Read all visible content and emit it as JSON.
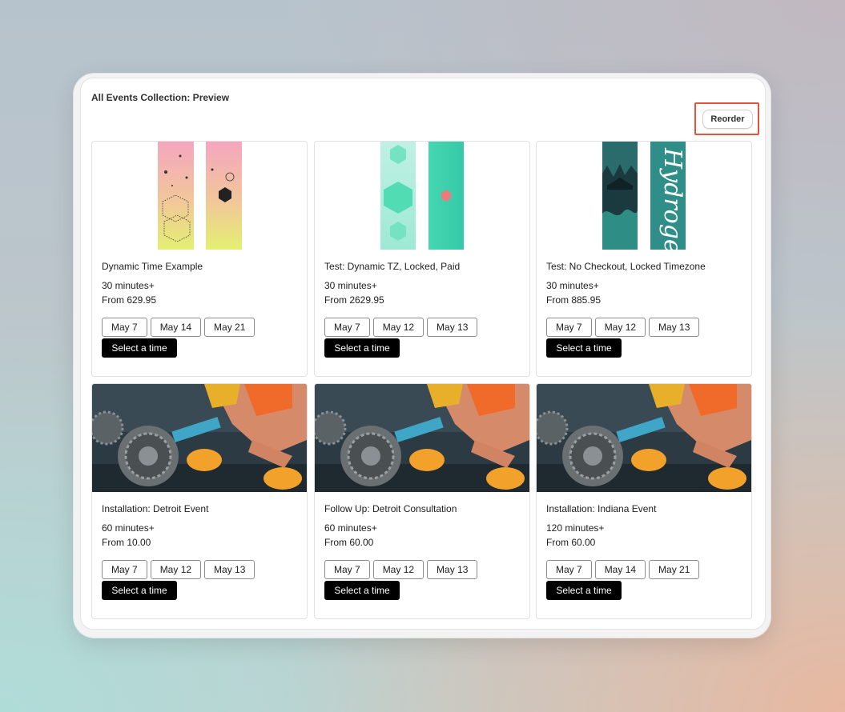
{
  "page": {
    "title": "All Events Collection: Preview",
    "reorder_label": "Reorder"
  },
  "products": [
    {
      "name": "Dynamic Time Example",
      "duration": "30 minutes+",
      "price": "From 629.95",
      "dates": [
        "May 7",
        "May 14",
        "May 21"
      ],
      "cta": "Select a time",
      "image": "snowboard-pink"
    },
    {
      "name": "Test: Dynamic TZ, Locked, Paid",
      "duration": "30 minutes+",
      "price": "From 2629.95",
      "dates": [
        "May 7",
        "May 12",
        "May 13"
      ],
      "cta": "Select a time",
      "image": "snowboard-mint"
    },
    {
      "name": "Test: No Checkout, Locked Timezone",
      "duration": "30 minutes+",
      "price": "From 885.95",
      "dates": [
        "May 7",
        "May 12",
        "May 13"
      ],
      "cta": "Select a time",
      "image": "snowboard-hydrogen"
    },
    {
      "name": "Installation: Detroit Event",
      "duration": "60 minutes+",
      "price": "From 10.00",
      "dates": [
        "May 7",
        "May 12",
        "May 13"
      ],
      "cta": "Select a time",
      "image": "mechanic-gears"
    },
    {
      "name": "Follow Up: Detroit Consultation",
      "duration": "60 minutes+",
      "price": "From 60.00",
      "dates": [
        "May 7",
        "May 12",
        "May 13"
      ],
      "cta": "Select a time",
      "image": "mechanic-gears"
    },
    {
      "name": "Installation: Indiana Event",
      "duration": "120 minutes+",
      "price": "From 60.00",
      "dates": [
        "May 7",
        "May 14",
        "May 21"
      ],
      "cta": "Select a time",
      "image": "mechanic-gears"
    }
  ],
  "colors": {
    "highlight": "#e5533f",
    "button_bg": "#000000",
    "button_text": "#ffffff"
  },
  "image_text": {
    "hydrogen": "Hydrogen"
  }
}
